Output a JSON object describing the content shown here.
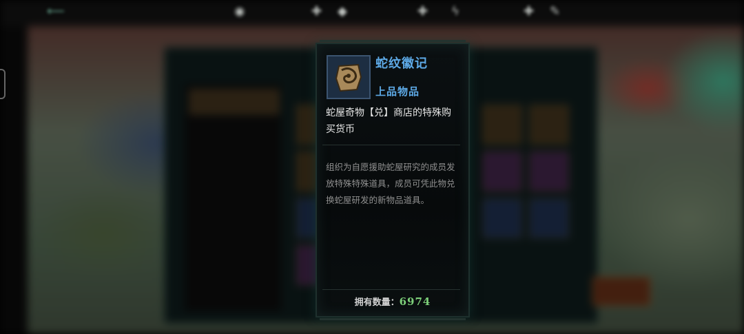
{
  "tooltip": {
    "item_name": "蛇纹徽记",
    "rarity": "上品物品",
    "rarity_color": "#5da9e6",
    "description": "蛇屋奇物【兑】商店的特殊购买货币",
    "lore": "组织为自愿援助蛇屋研究的成员发放特殊特殊道具，成员可凭此物兑换蛇屋研发的新物品道具。",
    "owned_label": "拥有数量：",
    "owned_value": "6974",
    "owned_value_color": "#7dd07a",
    "icon": "serpent-badge-icon"
  }
}
